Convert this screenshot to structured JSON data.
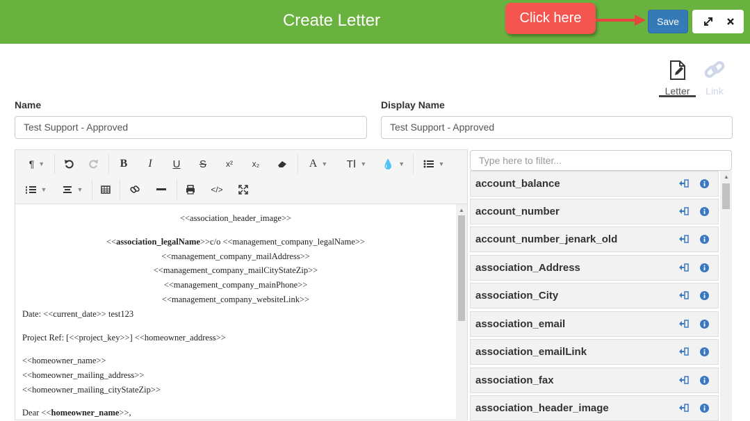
{
  "header": {
    "title": "Create Letter",
    "callout": "Click here",
    "save_label": "Save"
  },
  "tabs": {
    "letter": "Letter",
    "link": "Link"
  },
  "form": {
    "name_label": "Name",
    "name_value": "Test Support - Approved",
    "display_label": "Display Name",
    "display_value": "Test Support - Approved"
  },
  "editor": {
    "lines": [
      "<<association_header_image>>",
      "<<",
      "association_legalName",
      ">>c/o <<management_company_legalName>>",
      "<<management_company_mailAddress>>",
      "<<management_company_mailCityStateZip>>",
      "<<management_company_mainPhone>>",
      "<<management_company_websiteLink>>",
      "Date: <<current_date>> test123",
      "Project Ref: [<<project_key>>] <<homeowner_address>>",
      "<<homeowner_name>>",
      "<<homeowner_mailing_address>>",
      "<<homeowner_mailing_cityStateZip>>",
      "Dear <<",
      "homeowner_name",
      ">>,"
    ]
  },
  "fields": {
    "filter_placeholder": "Type here to filter...",
    "items": [
      "account_balance",
      "account_number",
      "account_number_jenark_old",
      "association_Address",
      "association_City",
      "association_email",
      "association_emailLink",
      "association_fax",
      "association_header_image"
    ]
  },
  "colors": {
    "header_green": "#6ab23f",
    "save_blue": "#337ab7",
    "callout_red": "#f4554e",
    "icon_blue": "#3a78c0"
  },
  "icons": [
    "paragraph-icon",
    "undo-icon",
    "redo-icon",
    "bold-icon",
    "italic-icon",
    "underline-icon",
    "strikethrough-icon",
    "superscript-icon",
    "subscript-icon",
    "eraser-icon",
    "font-color-icon",
    "font-size-icon",
    "ink-icon",
    "list-icon",
    "numbered-list-icon",
    "align-icon",
    "table-icon",
    "link-icon",
    "hr-icon",
    "print-icon",
    "code-icon",
    "fullscreen-icon",
    "insert-icon",
    "info-icon",
    "expand-icon",
    "close-icon",
    "edit-document-icon",
    "chain-link-icon"
  ]
}
